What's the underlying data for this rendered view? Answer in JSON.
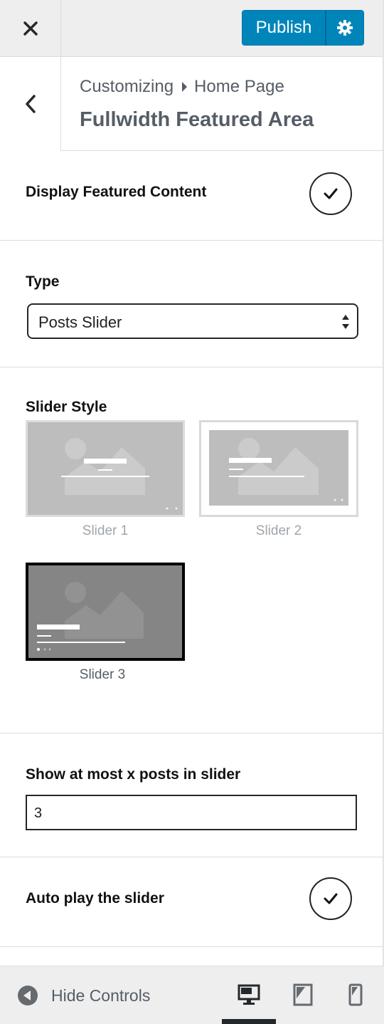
{
  "header": {
    "close_icon": "close-icon",
    "publish_label": "Publish",
    "settings_icon": "gear-icon",
    "accent_color": "#0085ba"
  },
  "section": {
    "breadcrumb_root": "Customizing",
    "breadcrumb_page": "Home Page",
    "title": "Fullwidth Featured Area"
  },
  "controls": {
    "display_featured": {
      "label": "Display Featured Content",
      "checked": true
    },
    "type": {
      "label": "Type",
      "value": "Posts Slider"
    },
    "slider_style": {
      "label": "Slider Style",
      "options": [
        {
          "label": "Slider 1",
          "selected": false
        },
        {
          "label": "Slider 2",
          "selected": false
        },
        {
          "label": "Slider 3",
          "selected": true
        }
      ]
    },
    "max_posts": {
      "label": "Show at most x posts in slider",
      "value": "3"
    },
    "autoplay": {
      "label": "Auto play the slider",
      "checked": true
    }
  },
  "footer": {
    "hide_controls_label": "Hide Controls",
    "devices": [
      "desktop",
      "tablet",
      "mobile"
    ],
    "active_device": "desktop"
  }
}
